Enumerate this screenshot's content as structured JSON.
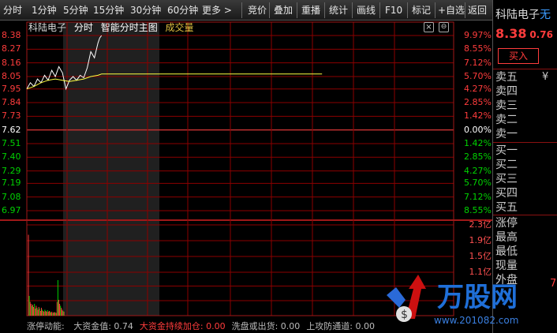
{
  "colors": {
    "up": "#ff3c3c",
    "down": "#00d200",
    "flat": "#ffffff",
    "grid": "#8b0000",
    "accent": "#ff4040"
  },
  "toolbar": {
    "left": [
      "分时",
      "1分钟",
      "5分钟",
      "15分钟",
      "30分钟",
      "60分钟",
      "更多 >"
    ],
    "right": [
      "竞价",
      "叠加",
      "重播",
      "统计",
      "画线",
      "F10",
      "标记",
      "+自选",
      "返回"
    ]
  },
  "chart_header": {
    "stock_name": "科陆电子",
    "mode": "分时",
    "main_chart": "智能分时主图",
    "volume_label": "成交量"
  },
  "price_axis": {
    "left_labels": [
      "8.38",
      "8.27",
      "8.16",
      "8.05",
      "7.95",
      "7.84",
      "7.73",
      "7.62",
      "7.51",
      "7.40",
      "7.29",
      "7.19",
      "7.08",
      "6.97"
    ],
    "right_labels": [
      "9.97%",
      "8.55%",
      "7.12%",
      "5.70%",
      "4.27%",
      "2.85%",
      "1.42%",
      "0.00%",
      "1.42%",
      "2.85%",
      "4.27%",
      "5.70%",
      "7.12%",
      "8.55%"
    ]
  },
  "volume_axis": {
    "labels": [
      "2.3亿",
      "1.9亿",
      "1.5亿",
      "1.1亿"
    ]
  },
  "chart_data": {
    "type": "line",
    "prev_close": 7.62,
    "ylim": [
      6.97,
      8.38
    ],
    "x_max_minutes": 240,
    "series": [
      {
        "points": [
          [
            0,
            7.95
          ],
          [
            2,
            8.0
          ],
          [
            4,
            7.97
          ],
          [
            6,
            8.03
          ],
          [
            8,
            8.0
          ],
          [
            10,
            8.06
          ],
          [
            12,
            8.02
          ],
          [
            14,
            8.1
          ],
          [
            16,
            8.05
          ],
          [
            18,
            8.13
          ],
          [
            20,
            8.08
          ],
          [
            22,
            7.95
          ],
          [
            24,
            8.02
          ],
          [
            26,
            8.05
          ],
          [
            28,
            8.02
          ],
          [
            30,
            8.06
          ],
          [
            32,
            8.04
          ],
          [
            34,
            8.12
          ],
          [
            36,
            8.25
          ],
          [
            38,
            8.2
          ],
          [
            40,
            8.32
          ],
          [
            41,
            8.36
          ],
          [
            42,
            8.38
          ]
        ]
      },
      {
        "points": [
          [
            0,
            7.95
          ],
          [
            4,
            7.97
          ],
          [
            8,
            8.0
          ],
          [
            12,
            8.02
          ],
          [
            16,
            8.03
          ],
          [
            20,
            8.02
          ],
          [
            24,
            8.01
          ],
          [
            28,
            8.02
          ],
          [
            32,
            8.03
          ],
          [
            36,
            8.05
          ],
          [
            40,
            8.06
          ],
          [
            42,
            8.07
          ],
          [
            120,
            8.07
          ],
          [
            166,
            8.07
          ]
        ]
      }
    ],
    "volume": {
      "ylim": [
        0,
        2.3
      ],
      "values": [
        2.05,
        0.5,
        0.35,
        0.3,
        0.25,
        0.28,
        0.22,
        0.3,
        0.18,
        0.25,
        0.2,
        0.15,
        0.22,
        0.18,
        0.12,
        0.2,
        0.15,
        0.12,
        0.1,
        0.15,
        0.12,
        0.1,
        0.14,
        0.1,
        0.12,
        0.1,
        0.08,
        0.1,
        0.07,
        0.08,
        0.09,
        0.08,
        0.07,
        0.35,
        0.9,
        0.4,
        0.3,
        0.25,
        0.2,
        0.15,
        0.12,
        0.1
      ]
    }
  },
  "side_panel": {
    "stock_name": "科陆电子",
    "stock_name_suffix": "无",
    "price": "8.38",
    "change": "0.76",
    "buy_button": "买入",
    "sell_levels": [
      "卖五",
      "卖四",
      "卖三",
      "卖二",
      "卖一"
    ],
    "buy_levels": [
      "买一",
      "买二",
      "买三",
      "买四",
      "买五"
    ],
    "stats": [
      "涨停",
      "最高",
      "最低",
      "现量",
      "外盘"
    ],
    "currency_symbol": "¥",
    "right_digit": "7"
  },
  "info_bar": [
    {
      "label": "涨停动能",
      "value": "",
      "color": "#bbbbbb"
    },
    {
      "label": "大资金值",
      "value": "0.74",
      "color": "#bbbbbb"
    },
    {
      "label": "大资金持续加仓",
      "value": "0.00",
      "color": "#ff3c3c"
    },
    {
      "label": "洗盘或出货",
      "value": "0.00",
      "color": "#bbbbbb"
    },
    {
      "label": "上攻防通道",
      "value": "0.00",
      "color": "#bbbbbb"
    }
  ],
  "watermark": {
    "brand": "万股网",
    "url": "www.201082.com"
  }
}
